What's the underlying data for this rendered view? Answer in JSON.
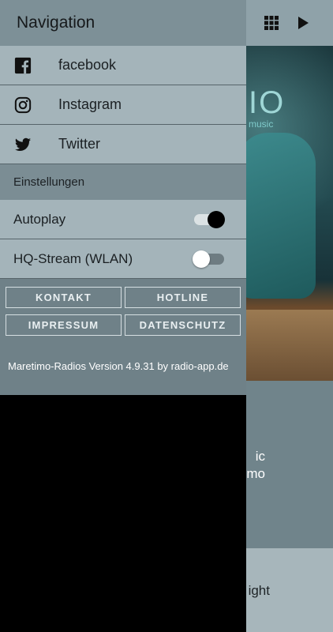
{
  "topbar": {
    "grid_icon": "grid-icon",
    "play_icon": "play-icon"
  },
  "background": {
    "hero_logo": "IO",
    "hero_logo_sub": "music",
    "line1": "ic",
    "line2": "mo",
    "line3": "ight"
  },
  "drawer": {
    "title": "Navigation",
    "social": [
      {
        "label": "facebook",
        "icon": "facebook-icon"
      },
      {
        "label": "Instagram",
        "icon": "instagram-icon"
      },
      {
        "label": "Twitter",
        "icon": "twitter-icon"
      }
    ],
    "settings_title": "Einstellungen",
    "settings": [
      {
        "label": "Autoplay",
        "enabled": true
      },
      {
        "label": "HQ-Stream (WLAN)",
        "enabled": false
      }
    ],
    "buttons": [
      "KONTAKT",
      "HOTLINE",
      "IMPRESSUM",
      "DATENSCHUTZ"
    ],
    "version": "Maretimo-Radios Version 4.9.31 by radio-app.de"
  },
  "colors": {
    "drawer_header": "#7d9097",
    "drawer_item": "#a4b4ba",
    "drawer_footer": "#6f8188"
  }
}
